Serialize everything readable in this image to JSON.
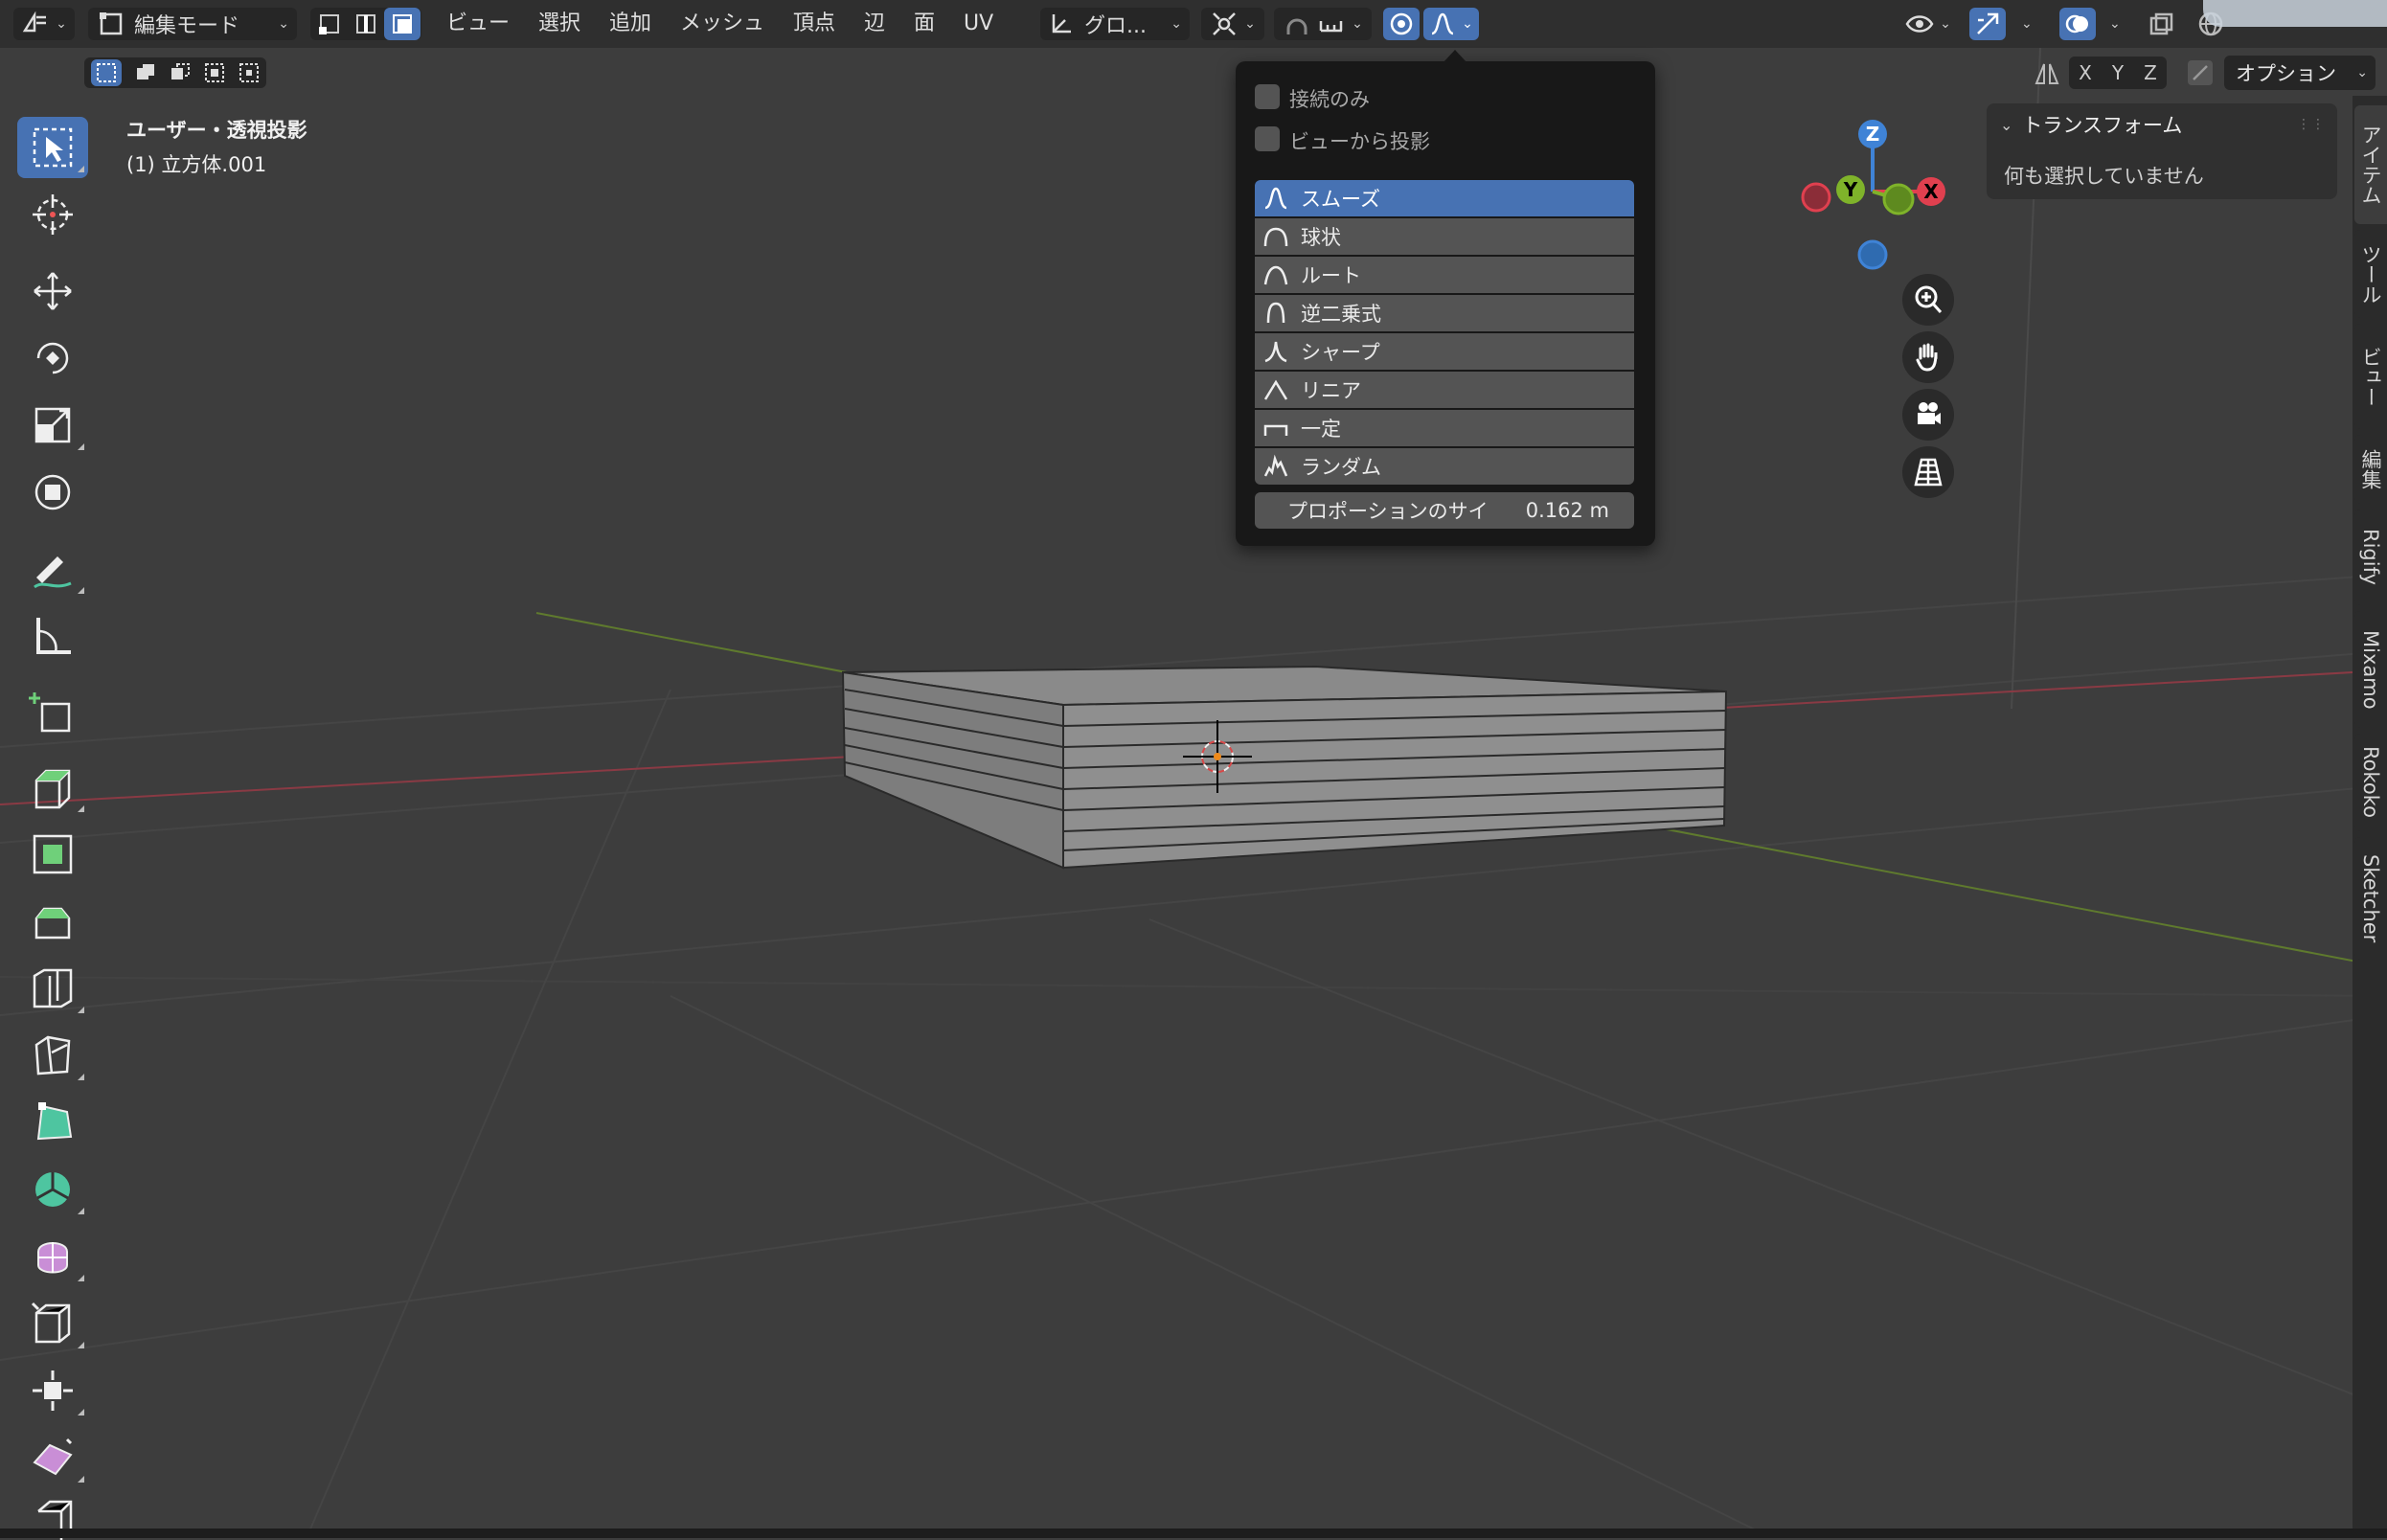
{
  "header": {
    "mode_label": "編集モード",
    "menus": [
      "ビュー",
      "選択",
      "追加",
      "メッシュ",
      "頂点",
      "辺",
      "面",
      "UV"
    ],
    "transform_orientation": "グロ...",
    "axis_labels": [
      "X",
      "Y",
      "Z"
    ],
    "options_label": "オプション"
  },
  "viewport": {
    "view_name": "ユーザー・透視投影",
    "object_name": "(1) 立方体.001"
  },
  "proportional_popup": {
    "connected_only": "接続のみ",
    "projected_from_view": "ビューから投影",
    "falloff_options": [
      "スムーズ",
      "球状",
      "ルート",
      "逆二乗式",
      "シャープ",
      "リニア",
      "一定",
      "ランダム"
    ],
    "selected_falloff": "スムーズ",
    "size_label": "プロポーションのサイ",
    "size_value": "0.162 m"
  },
  "gizmo": {
    "z": "Z",
    "y": "Y",
    "x": "X"
  },
  "sidebar": {
    "panel_title": "トランスフォーム",
    "panel_message": "何も選択していません",
    "tabs": [
      "アイテム",
      "ツール",
      "ビュー",
      "編集",
      "Rigify",
      "Mixamo",
      "Rokoko",
      "Sketcher"
    ]
  },
  "colors": {
    "accent": "#4772b3",
    "x_axis": "#e0404f",
    "y_axis": "#7fb32a",
    "z_axis": "#3f83d6"
  }
}
